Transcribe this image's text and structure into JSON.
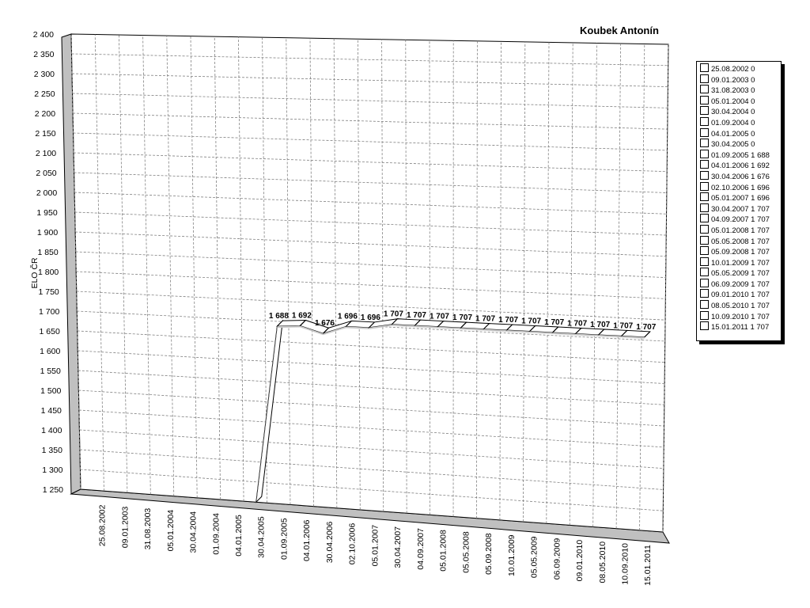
{
  "chart_data": {
    "type": "line",
    "title": "Koubek Antonín",
    "ylabel": "ELO ČR",
    "xlabel": "",
    "ylim": [
      1250,
      2400
    ],
    "y_ticks": [
      "2 400",
      "2 350",
      "2 300",
      "2 250",
      "2 200",
      "2 150",
      "2 100",
      "2 050",
      "2 000",
      "1 950",
      "1 900",
      "1 850",
      "1 800",
      "1 750",
      "1 700",
      "1 650",
      "1 600",
      "1 550",
      "1 500",
      "1 450",
      "1 400",
      "1 350",
      "1 300",
      "1 250"
    ],
    "categories": [
      "25.08.2002",
      "09.01.2003",
      "31.08.2003",
      "05.01.2004",
      "30.04.2004",
      "01.09.2004",
      "04.01.2005",
      "30.04.2005",
      "01.09.2005",
      "04.01.2006",
      "30.04.2006",
      "02.10.2006",
      "05.01.2007",
      "30.04.2007",
      "04.09.2007",
      "05.01.2008",
      "05.05.2008",
      "05.09.2008",
      "10.01.2009",
      "05.05.2009",
      "06.09.2009",
      "09.01.2010",
      "08.05.2010",
      "10.09.2010",
      "15.01.2011"
    ],
    "values": [
      0,
      0,
      0,
      0,
      0,
      0,
      0,
      0,
      1688,
      1692,
      1676,
      1696,
      1696,
      1707,
      1707,
      1707,
      1707,
      1707,
      1707,
      1707,
      1707,
      1707,
      1707,
      1707,
      1707
    ],
    "data_labels": [
      "",
      "",
      "",
      "",
      "",
      "",
      "",
      "",
      "1 688",
      "1 692",
      "1 676",
      "1 696",
      "1 696",
      "1 707",
      "1 707",
      "1 707",
      "1 707",
      "1 707",
      "1 707",
      "1 707",
      "1 707",
      "1 707",
      "1 707",
      "1 707",
      "1 707"
    ],
    "grid": true,
    "legend_position": "right",
    "colors": {
      "line": "#ffffff",
      "line_side": "#c8c8c8",
      "grid": "#808080",
      "wall": "#c0c0c0"
    }
  },
  "legend": {
    "items": [
      "25.08.2002 0",
      "09.01.2003 0",
      "31.08.2003 0",
      "05.01.2004 0",
      "30.04.2004 0",
      "01.09.2004 0",
      "04.01.2005 0",
      "30.04.2005 0",
      "01.09.2005 1 688",
      "04.01.2006 1 692",
      "30.04.2006 1 676",
      "02.10.2006 1 696",
      "05.01.2007 1 696",
      "30.04.2007 1 707",
      "04.09.2007 1 707",
      "05.01.2008 1 707",
      "05.05.2008 1 707",
      "05.09.2008 1 707",
      "10.01.2009 1 707",
      "05.05.2009 1 707",
      "06.09.2009 1 707",
      "09.01.2010 1 707",
      "08.05.2010 1 707",
      "10.09.2010 1 707",
      "15.01.2011 1 707"
    ]
  }
}
